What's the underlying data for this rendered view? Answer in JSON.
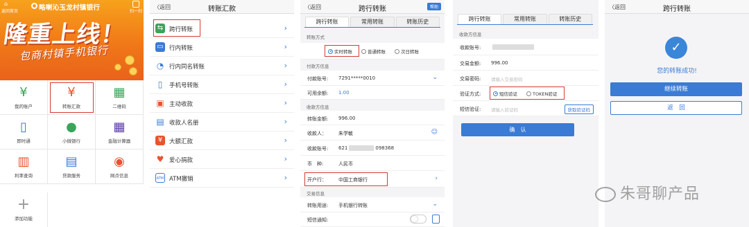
{
  "home": {
    "top_left": "⌂",
    "top_left_label": "返回首页",
    "bank_name": "略喇沁玉龙村镇银行",
    "top_right_label": "扫一扫",
    "headline": "隆重上线！",
    "subline": "包商村镇手机银行",
    "grid": [
      {
        "label": "我的账户",
        "icon": "¥"
      },
      {
        "label": "转账汇款",
        "icon": "¥"
      },
      {
        "label": "二维码",
        "icon": "▦"
      },
      {
        "label": "即时通",
        "icon": "▯"
      },
      {
        "label": "小微银行",
        "icon": "●"
      },
      {
        "label": "金融计算器",
        "icon": "▦"
      },
      {
        "label": "利率查询",
        "icon": "▥"
      },
      {
        "label": "贷款服务",
        "icon": "▤"
      },
      {
        "label": "网点信息",
        "icon": "◉"
      },
      {
        "label": "添加功能",
        "icon": "+"
      }
    ]
  },
  "menu": {
    "back": "〈返回",
    "title": "转账汇款",
    "items": [
      {
        "label": "跨行转账",
        "icon": "⇆"
      },
      {
        "label": "行内转账",
        "icon": "▭"
      },
      {
        "label": "行内同名转账",
        "icon": "◔"
      },
      {
        "label": "手机号转账",
        "icon": "▯"
      },
      {
        "label": "主动收款",
        "icon": "▣"
      },
      {
        "label": "收款人名册",
        "icon": "▤"
      },
      {
        "label": "大额汇款",
        "icon": "¥"
      },
      {
        "label": "爱心捐款",
        "icon": "♥"
      },
      {
        "label": "ATM撤销",
        "icon": "ATM"
      }
    ]
  },
  "form": {
    "back": "〈返回",
    "title": "跨行转账",
    "help": "帮助",
    "tabs": [
      "跨行转账",
      "常用转账",
      "转账历史"
    ],
    "method_label": "转账方式",
    "methods": [
      "实时转账",
      "普通转账",
      "次日转账"
    ],
    "payer_section": "付款方信息",
    "pay_account_label": "付款账号:",
    "pay_account": "7291*****0010",
    "balance_label": "可用余额:",
    "balance": "1.00",
    "payee_section": "收款方信息",
    "amount_label": "转账金额:",
    "amount": "996.00",
    "payee_label": "收款人：",
    "payee": "朱学敏",
    "account_label": "收款账号:",
    "account_prefix": "621",
    "account_suffix": "098368",
    "currency_label": "币　种:",
    "currency": "人民币",
    "bank_label": "开户行：",
    "bank": "中国工商银行",
    "txn_section": "交易信息",
    "purpose_label": "转账用途:",
    "purpose": "手机银行转账",
    "sms_label": "短信通知:"
  },
  "verify": {
    "tabs": [
      "跨行转账",
      "常用转账",
      "转账历史"
    ],
    "section": "收款方信息",
    "account_label": "收款账号:",
    "amount_label": "交易金额:",
    "amount": "996.00",
    "pwd_label": "交易密码:",
    "pwd_placeholder": "请输入交易密码",
    "method_label": "验证方式:",
    "methods": [
      "短信验证",
      "TOKEN验证"
    ],
    "code_label": "短信验证:",
    "code_placeholder": "请输入验证码",
    "get_code": "获取验证码",
    "confirm": "确　认"
  },
  "success": {
    "back": "〈返回",
    "title": "跨行转账",
    "message": "您的转账成功!",
    "continue": "继续转账",
    "return": "返　回"
  },
  "watermark": "朱哥聊产品"
}
